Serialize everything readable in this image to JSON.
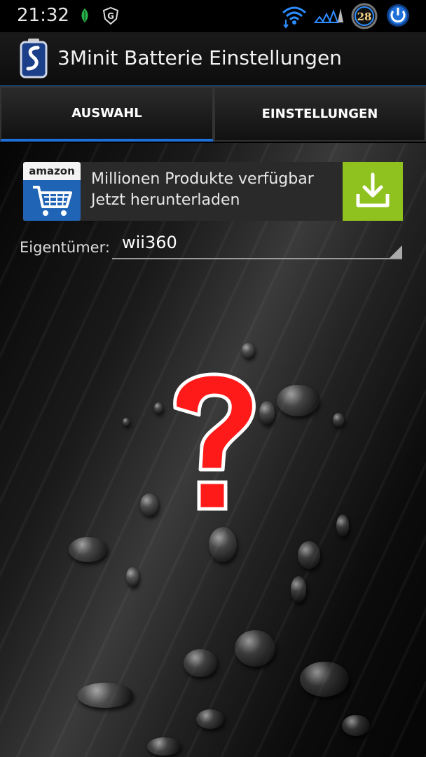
{
  "status_bar": {
    "time": "21:32",
    "badge_count": "28",
    "icons": [
      "leaf-icon",
      "g-shield-icon",
      "wifi-icon",
      "signal-icon",
      "battery-clock-icon",
      "power-icon"
    ]
  },
  "app_bar": {
    "title": "3Minit Batterie Einstellungen",
    "icon": "battery-app-icon",
    "accent_color": "#1e6fd8"
  },
  "tabs": [
    {
      "label": "AUSWAHL",
      "active": true
    },
    {
      "label": "EINSTELLUNGEN",
      "active": false
    }
  ],
  "ad": {
    "brand": "amazon",
    "line1": "Millionen Produkte verfügbar",
    "line2": "Jetzt herunterladen",
    "download_color": "#8fc21f"
  },
  "owner": {
    "label": "Eigentümer:",
    "value": "wii360"
  },
  "main": {
    "placeholder_icon": "question-mark-icon",
    "placeholder_color": "#ff1a1a"
  }
}
